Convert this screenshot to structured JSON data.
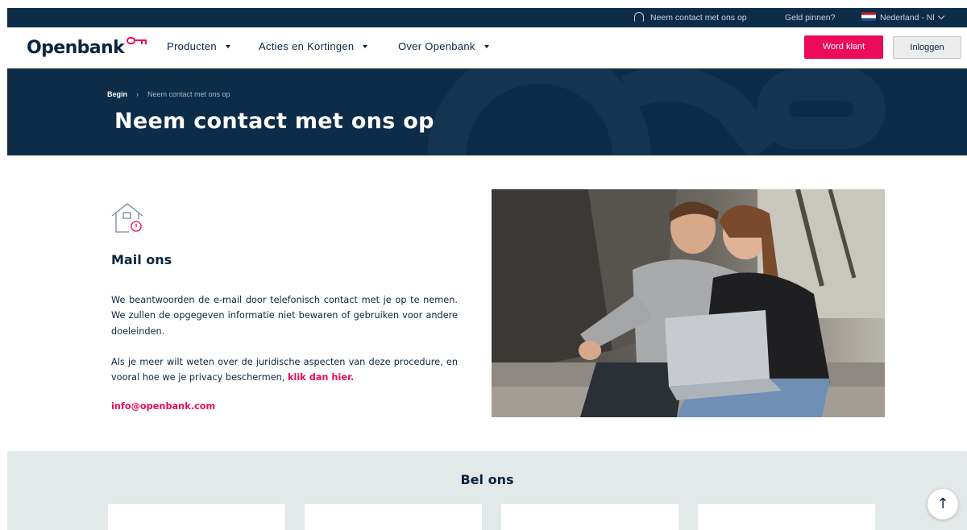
{
  "topbar": {
    "contact_label": "Neem contact met ons op",
    "cash_label": "Geld pinnen?",
    "country_label": "Nederland - Nl"
  },
  "nav": {
    "logo_text": "Openbank",
    "items": [
      {
        "label": "Producten"
      },
      {
        "label": "Acties en Kortingen"
      },
      {
        "label": "Over Openbank"
      }
    ],
    "join_label": "Word klant",
    "login_label": "Inloggen"
  },
  "hero": {
    "breadcrumb_home": "Begin",
    "breadcrumb_current": "Neem contact met ons op",
    "title": "Neem contact met ons op"
  },
  "mail": {
    "title": "Mail ons",
    "paragraph1": "We beantwoorden de e-mail door telefonisch contact met je op te nemen. We zullen de opgegeven informatie niet bewaren of gebruiken voor andere doeleinden.",
    "paragraph2": "Als je meer wilt weten over de juridische aspecten van deze procedure, en vooral hoe we je privacy beschermen,",
    "privacy_link": "klik dan hier.",
    "email": "info@openbank.com"
  },
  "call": {
    "title": "Bel ons"
  },
  "colors": {
    "brand_navy": "#0d2c47",
    "brand_pink": "#ec0a5b",
    "section_gray": "#e3e8e9"
  },
  "icons": {
    "contact": "headset-icon",
    "country": "flag-nl-icon",
    "mail": "house-mail-icon",
    "scroll": "arrow-up-icon"
  }
}
